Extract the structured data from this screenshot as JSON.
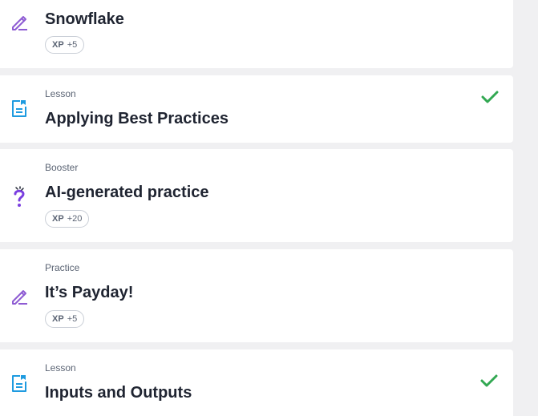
{
  "header": {
    "cta_color": "#ffa200"
  },
  "colors": {
    "practice_icon": "#8e5bd3",
    "lesson_icon": "#1e9be0",
    "booster_icon": "#7a3ee0",
    "check": "#32a852"
  },
  "items": [
    {
      "icon": "pencil-icon",
      "type": "",
      "title": "Snowflake",
      "xp_label": "XP",
      "xp_value": "+5",
      "completed": false
    },
    {
      "icon": "lesson-doc-icon",
      "type": "Lesson",
      "title": "Applying Best Practices",
      "completed": true
    },
    {
      "icon": "question-sparkle-icon",
      "type": "Booster",
      "title": "AI-generated practice",
      "xp_label": "XP",
      "xp_value": "+20",
      "completed": false
    },
    {
      "icon": "pencil-icon",
      "type": "Practice",
      "title": "It’s Payday!",
      "xp_label": "XP",
      "xp_value": "+5",
      "completed": false
    },
    {
      "icon": "lesson-doc-icon",
      "type": "Lesson",
      "title": "Inputs and Outputs",
      "completed": true
    }
  ]
}
